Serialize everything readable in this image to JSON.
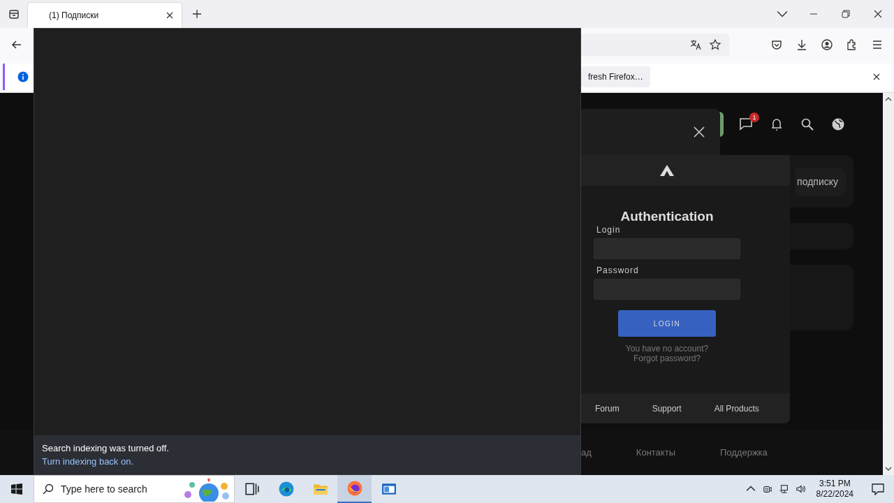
{
  "browser": {
    "tabs": [
      {
        "title": "(1) Подписки",
        "selected": true
      }
    ],
    "refresh_button": "fresh Firefox…"
  },
  "page": {
    "message_badge": "1",
    "subscribe_button": "подписку",
    "footer_links": [
      "ад",
      "Контакты",
      "Поддержка"
    ]
  },
  "login_dialog": {
    "title": "Authentication",
    "fields": [
      {
        "label": "Login"
      },
      {
        "label": "Password"
      }
    ],
    "submit": "LOGIN",
    "links": [
      "You have no account?",
      "Forgot password?"
    ],
    "footer_links": [
      "Forum",
      "Support",
      "All Products"
    ]
  },
  "search_flyout": {
    "message": "Search indexing was turned off.",
    "link": "Turn indexing back on."
  },
  "taskbar": {
    "search_placeholder": "Type here to search",
    "apps": [
      {
        "kind": "taskview",
        "selected": false
      },
      {
        "kind": "edge",
        "selected": false
      },
      {
        "kind": "explorer",
        "selected": false
      },
      {
        "kind": "firefox",
        "selected": true
      },
      {
        "kind": "window",
        "selected": false
      }
    ],
    "time": "3:51 PM",
    "date": "8/22/2024"
  }
}
